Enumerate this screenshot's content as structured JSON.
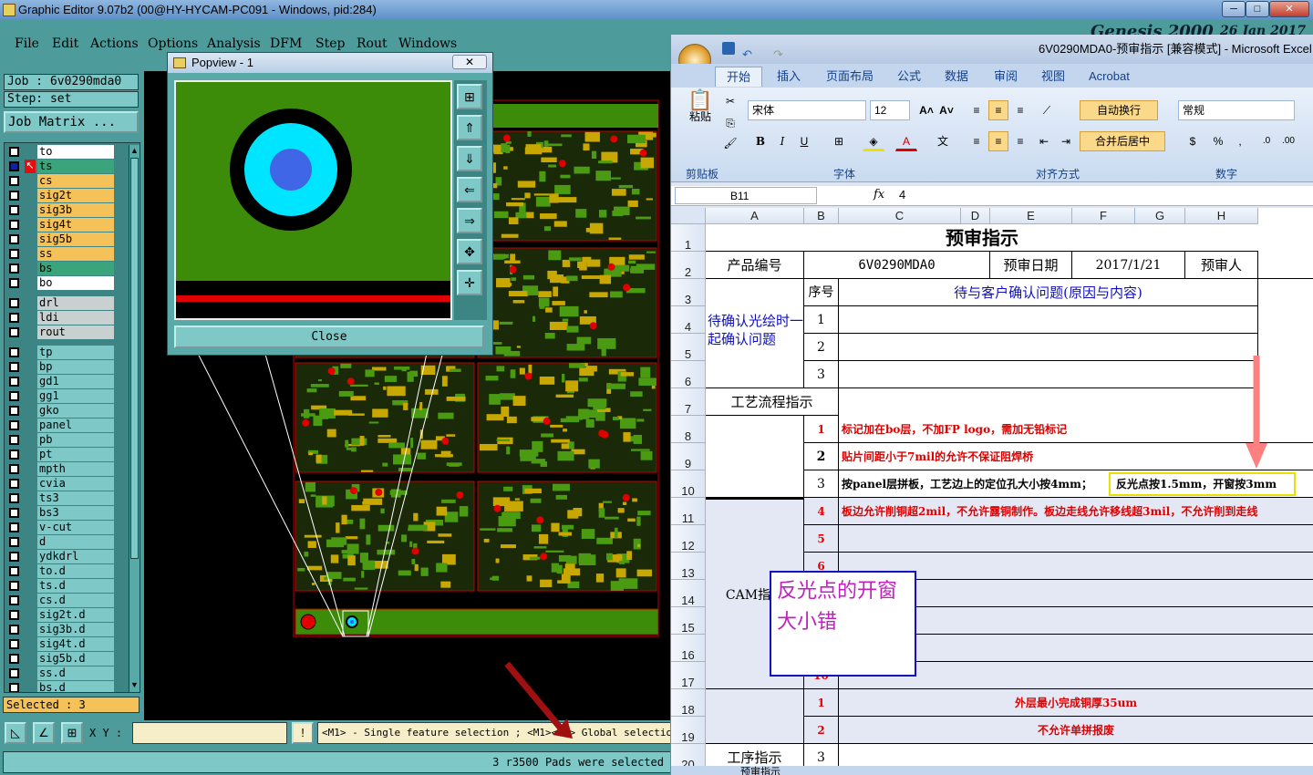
{
  "genesis": {
    "title": "Graphic Editor 9.07b2 (00@HY-HYCAM-PC091 - Windows, pid:284)",
    "brand": "Genesis 2000",
    "date": "26 Jan 2017",
    "menu": [
      "File",
      "Edit",
      "Actions",
      "Options",
      "Analysis",
      "DFM",
      "Step",
      "Rout",
      "Windows"
    ],
    "job_label": "Job : 6v0290mda0",
    "step_label": "Step: set",
    "matrix_button": "Job Matrix ...",
    "layers_top": [
      {
        "name": "to",
        "color": "#ffffff",
        "state": "off"
      },
      {
        "name": "ts",
        "color": "#3aa57a",
        "state": "work"
      },
      {
        "name": "cs",
        "color": "#f5c25a",
        "state": "off"
      },
      {
        "name": "sig2t",
        "color": "#f5c25a",
        "state": "off"
      },
      {
        "name": "sig3b",
        "color": "#f5c25a",
        "state": "off"
      },
      {
        "name": "sig4t",
        "color": "#f5c25a",
        "state": "off"
      },
      {
        "name": "sig5b",
        "color": "#f5c25a",
        "state": "off"
      },
      {
        "name": "ss",
        "color": "#f5c25a",
        "state": "off"
      },
      {
        "name": "bs",
        "color": "#3aa57a",
        "state": "off"
      },
      {
        "name": "bo",
        "color": "#ffffff",
        "state": "off"
      }
    ],
    "layers_drill": [
      "drl",
      "ldi",
      "rout"
    ],
    "layers_misc": [
      "tp",
      "bp",
      "gd1",
      "gg1",
      "gko",
      "panel",
      "pb",
      "pt",
      "mpth",
      "cvia",
      "ts3",
      "bs3",
      "v-cut",
      "d",
      "ydkdrl",
      "to.d",
      "ts.d",
      "cs.d",
      "sig2t.d",
      "sig3b.d",
      "sig4t.d",
      "sig5b.d",
      "ss.d",
      "bs.d"
    ],
    "selected": "Selected : 3",
    "xy_label": "X Y :",
    "message": "<M1> - Single feature selection ; <M1><M1> Global selection",
    "status": "3 r3500 Pads were selected"
  },
  "popview": {
    "title": "Popview - 1",
    "close_label": "Close"
  },
  "excel": {
    "title": "6V0290MDA0-预审指示 [兼容模式] - Microsoft Excel",
    "tabs": [
      "开始",
      "插入",
      "页面布局",
      "公式",
      "数据",
      "审阅",
      "视图",
      "Acrobat"
    ],
    "font_name": "宋体",
    "font_size": "12",
    "number_format": "常规",
    "wrap_text": "自动换行",
    "merge_center": "合并后居中",
    "paste": "粘贴",
    "groups": [
      "剪贴板",
      "字体",
      "对齐方式",
      "数字"
    ],
    "name_box": "B11",
    "formula_value": "4",
    "fx": "fx",
    "columns": [
      "A",
      "B",
      "C",
      "D",
      "E",
      "F",
      "G",
      "H"
    ],
    "row_numbers": [
      "1",
      "2",
      "3",
      "4",
      "5",
      "6",
      "7",
      "8",
      "9",
      "10",
      "11",
      "12",
      "13",
      "14",
      "15",
      "16",
      "17",
      "18",
      "19",
      "20"
    ],
    "sheet": {
      "title": "预审指示",
      "product_label": "产品编号",
      "product_value": "6V0290MDA0",
      "date_label": "预审日期",
      "date_value": "2017/1/21",
      "reviewer_label": "预审人",
      "seq_label": "序号",
      "issues_header": "待与客户确认问题(原因与内容)",
      "confirm_label": "待确认光绘时一起确认问题",
      "seq_1": "1",
      "seq_2": "2",
      "seq_3": "3",
      "process_label": "工艺流程指示",
      "p1": "标记加在bo层，不加FP logo，需加无铅标记",
      "p2": "贴片间距小于7mil的允许不保证阻焊桥",
      "p3_a": "按panel层拼板，工艺边上的定位孔大小按4mm；",
      "p3_b": "反光点按1.5mm，开窗按3mm",
      "cam_label": "CAM指示",
      "c4": "板边允许削铜超2mil，不允许露铜制作。板边走线允许移线超3mil，不允许削到走线",
      "c4_num": "4",
      "c5_num": "5",
      "c6_num": "6",
      "c10_num": "10",
      "l1": "外层最小完成铜厚35um",
      "l2": "不允许单拼报废",
      "l1_num": "1",
      "l2_num": "2",
      "l3_num": "3",
      "process2_label": "工序指示"
    },
    "note": "反光点的开窗大小错",
    "sheet_tab": "预审指示"
  }
}
